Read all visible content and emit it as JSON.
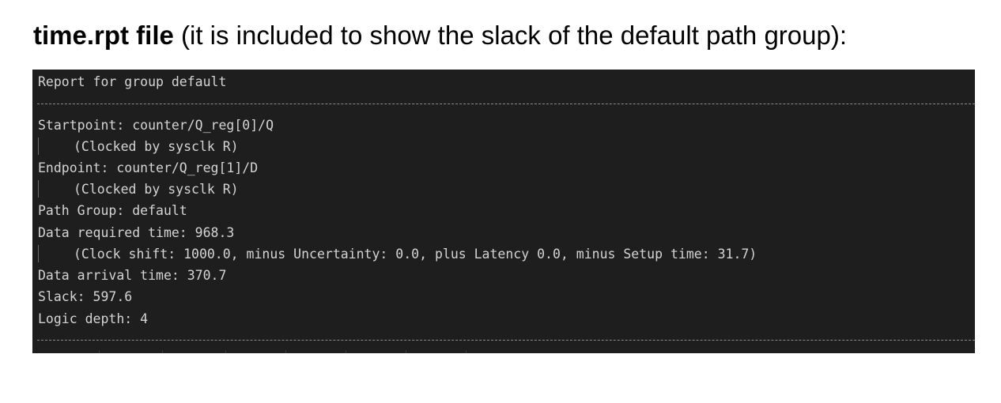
{
  "heading": {
    "bold": "time.rpt file",
    "rest": " (it is included to show the slack of the default path group):"
  },
  "report": {
    "title": "Report for group default",
    "separator": "------------------------------------------------------------------------------------------------------------------------",
    "startpoint": "Startpoint: counter/Q_reg[0]/Q",
    "startpoint_clock": "(Clocked by sysclk R)",
    "endpoint": "Endpoint: counter/Q_reg[1]/D",
    "endpoint_clock": "(Clocked by sysclk R)",
    "path_group": "Path Group: default",
    "data_required": "Data required time: 968.3",
    "data_required_detail": "(Clock shift: 1000.0, minus Uncertainty: 0.0, plus Latency 0.0, minus Setup time: 31.7)",
    "data_arrival": "Data arrival time: 370.7",
    "slack": "Slack: 597.6",
    "logic_depth": "Logic depth: 4"
  },
  "colors": {
    "terminal_background": "#1e1e1e",
    "terminal_text": "#d4d4d4",
    "separator": "#8a8a8a"
  }
}
